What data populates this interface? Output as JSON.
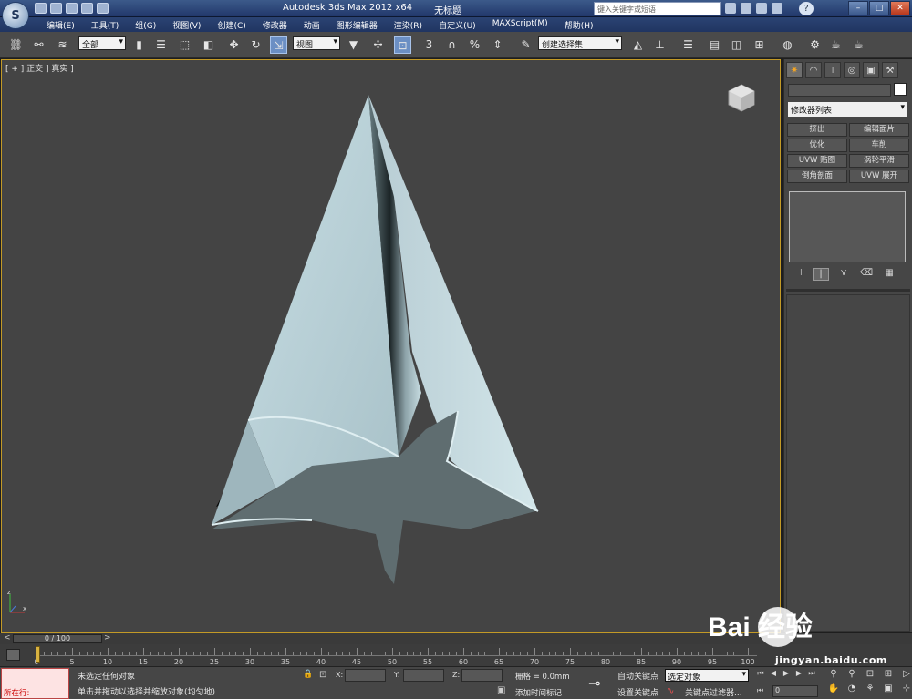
{
  "titlebar": {
    "app_title": "Autodesk 3ds Max  2012 x64",
    "doc_title": "无标题",
    "search_placeholder": "键入关键字或短语",
    "help_label": "?"
  },
  "menu": [
    "编辑(E)",
    "工具(T)",
    "组(G)",
    "视图(V)",
    "创建(C)",
    "修改器",
    "动画",
    "图形编辑器",
    "渲染(R)",
    "自定义(U)",
    "MAXScript(M)",
    "帮助(H)"
  ],
  "toolbar": {
    "filter_value": "全部",
    "refcoord_value": "视图",
    "named_selection_value": "创建选择集",
    "snap_label": "3",
    "percent_label": "%"
  },
  "viewport": {
    "label": "[ + ] 正交 ] 真实 ]",
    "axis_labels": [
      "z",
      "x"
    ]
  },
  "command_panel": {
    "modifier_list": "修改器列表",
    "modifier_buttons": [
      "挤出",
      "编辑面片",
      "优化",
      "车削",
      "UVW 贴图",
      "涡轮平滑",
      "倒角剖面",
      "UVW 展开"
    ]
  },
  "timeline": {
    "frame_display": "0 / 100",
    "ticks": [
      "0",
      "5",
      "10",
      "15",
      "20",
      "25",
      "30",
      "35",
      "40",
      "45",
      "50",
      "55",
      "60",
      "65",
      "70",
      "75",
      "80",
      "85",
      "90",
      "95",
      "100"
    ]
  },
  "status": {
    "maxscript_label": "所在行:",
    "selection_status": "未选定任何对象",
    "prompt": "单击并拖动以选择并缩放对象(均匀地)",
    "x_label": "X:",
    "y_label": "Y:",
    "z_label": "Z:",
    "grid": "栅格 = 0.0mm",
    "add_time_tag": "添加时间标记",
    "auto_key": "自动关键点",
    "set_key": "设置关键点",
    "selected_set": "选定对象",
    "key_filters": "关键点过滤器...",
    "frame_value": "0"
  },
  "watermark": {
    "brand": "Bai 经验",
    "url": "jingyan.baidu.com"
  }
}
